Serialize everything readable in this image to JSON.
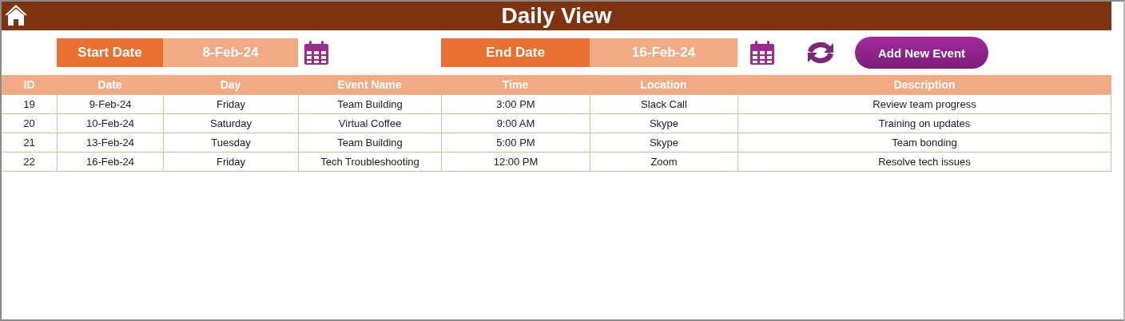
{
  "header": {
    "title": "Daily View"
  },
  "filters": [
    {
      "label": "Start Date",
      "value": "8-Feb-24"
    },
    {
      "label": "End Date",
      "value": "16-Feb-24"
    }
  ],
  "add_button": {
    "label": "Add New Event"
  },
  "table": {
    "columns": [
      "ID",
      "Date",
      "Day",
      "Event Name",
      "Time",
      "Location",
      "Description"
    ],
    "rows": [
      [
        "19",
        "9-Feb-24",
        "Friday",
        "Team Building",
        "3:00 PM",
        "Slack Call",
        "Review team progress"
      ],
      [
        "20",
        "10-Feb-24",
        "Saturday",
        "Virtual Coffee",
        "9:00 AM",
        "Skype",
        "Training on updates"
      ],
      [
        "21",
        "13-Feb-24",
        "Tuesday",
        "Team Building",
        "5:00 PM",
        "Skype",
        "Team bonding"
      ],
      [
        "22",
        "16-Feb-24",
        "Friday",
        "Tech Troubleshooting",
        "12:00 PM",
        "Zoom",
        "Resolve tech issues"
      ]
    ]
  }
}
